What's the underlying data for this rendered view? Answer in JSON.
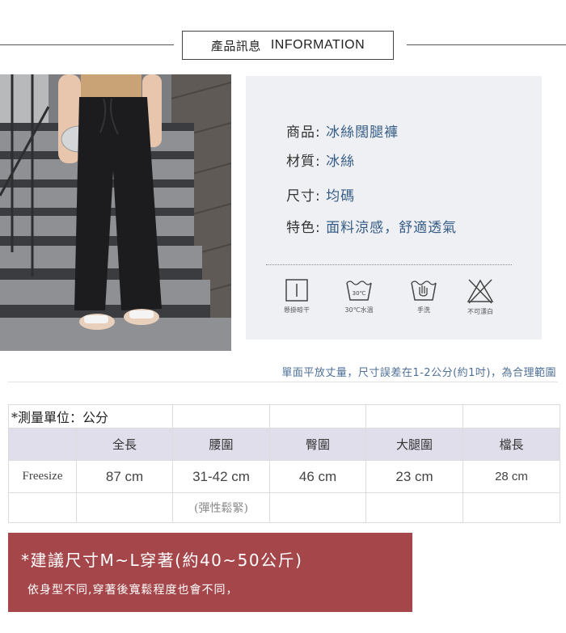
{
  "header": {
    "title_zh": "產品訊息",
    "title_en": "INFORMATION"
  },
  "product": {
    "specs": [
      {
        "key": "商品:",
        "value": "冰絲闊腿褲"
      },
      {
        "key": "材質:",
        "value": "冰絲"
      },
      {
        "key": "尺寸:",
        "value": "均碼"
      },
      {
        "key": "特色:",
        "value": "面料涼感，舒適透氣"
      }
    ],
    "care": [
      {
        "icon": "hang-dry-icon",
        "label": "懸掛晾干"
      },
      {
        "icon": "wash-30-icon",
        "label": "30℃水溫",
        "temp": "30℃"
      },
      {
        "icon": "hand-wash-icon",
        "label": "手洗"
      },
      {
        "icon": "no-bleach-icon",
        "label": "不可漂白"
      }
    ]
  },
  "note": "單面平放丈量，尺寸誤差在1-2公分(約1吋)，為合理範圍",
  "table": {
    "unit": "*測量單位：公分",
    "headers": [
      "",
      "全長",
      "腰圍",
      "臀圍",
      "大腿圍",
      "檔長"
    ],
    "rows": [
      [
        "Freesize",
        "87 cm",
        "31-42 cm",
        "46 cm",
        "23 cm",
        "28 cm"
      ],
      [
        "",
        "",
        "(彈性鬆緊)",
        "",
        "",
        ""
      ]
    ]
  },
  "banner": {
    "headline": "*建議尺寸M~L穿著(約40~50公斤)",
    "subtext": "依身型不同,穿著後寬鬆程度也會不同，"
  },
  "colors": {
    "panel_bg": "#eff0f4",
    "value_blue": "#355c86",
    "header_row": "#e1deeb",
    "banner_bg": "#a5474a"
  }
}
